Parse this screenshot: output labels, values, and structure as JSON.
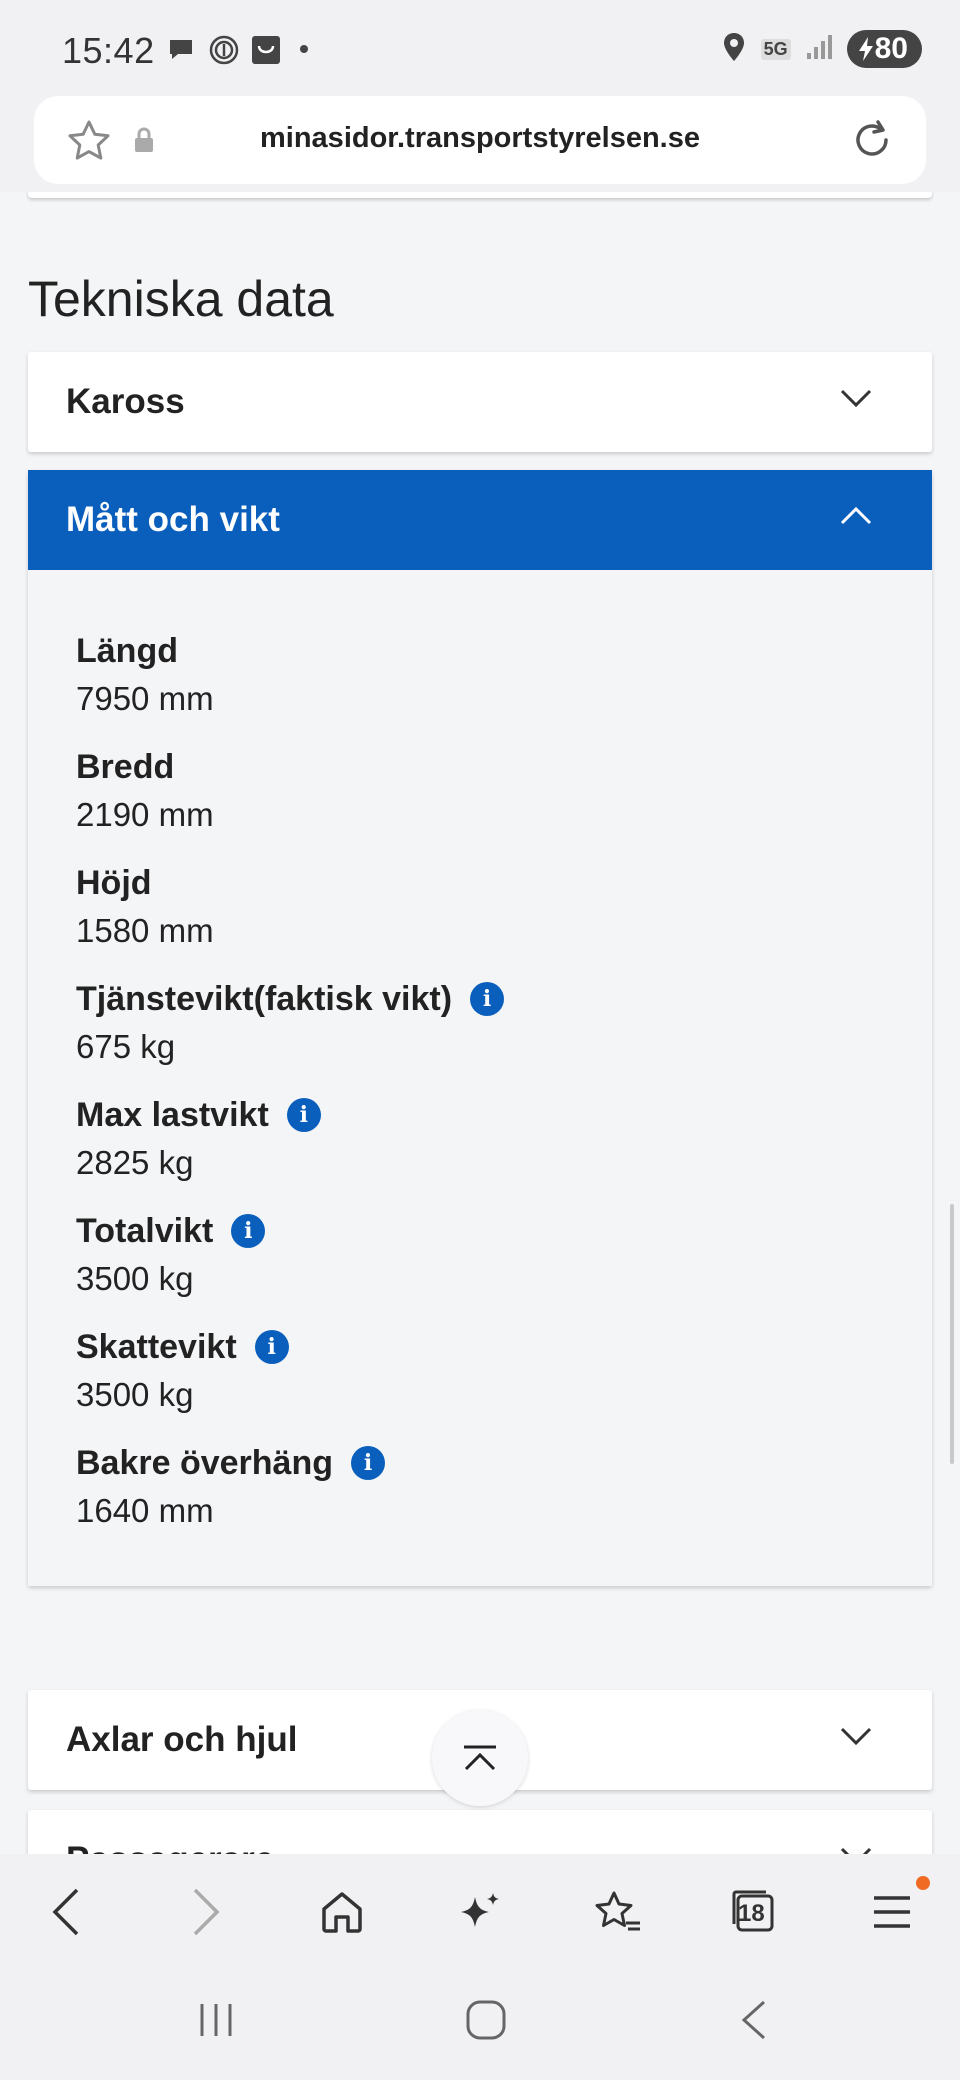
{
  "status_bar": {
    "time": "15:42",
    "network": "5G",
    "battery": "80",
    "icons": [
      "chat-icon",
      "fingerprint-icon",
      "bag-icon",
      "dot-icon",
      "location-icon",
      "signal-icon"
    ]
  },
  "browser": {
    "url": "minasidor.transportstyrelsen.se",
    "tab_count": "18"
  },
  "page": {
    "section_title": "Tekniska data",
    "accordions": [
      {
        "title": "Kaross",
        "expanded": false
      },
      {
        "title": "Mått och vikt",
        "expanded": true
      },
      {
        "title": "Axlar och hjul",
        "expanded": false
      },
      {
        "title": "Passagerare",
        "expanded": false
      }
    ],
    "specs": [
      {
        "label": "Längd",
        "value": "7950 mm",
        "info": false
      },
      {
        "label": "Bredd",
        "value": "2190 mm",
        "info": false
      },
      {
        "label": "Höjd",
        "value": "1580 mm",
        "info": false
      },
      {
        "label": "Tjänstevikt(faktisk vikt)",
        "value": "675 kg",
        "info": true
      },
      {
        "label": "Max lastvikt",
        "value": "2825 kg",
        "info": true
      },
      {
        "label": "Totalvikt",
        "value": "3500 kg",
        "info": true
      },
      {
        "label": "Skattevikt",
        "value": "3500 kg",
        "info": true
      },
      {
        "label": "Bakre överhäng",
        "value": "1640 mm",
        "info": true
      }
    ],
    "info_glyph": "i"
  },
  "colors": {
    "accent": "#0a5ebc",
    "background": "#f4f5f7",
    "notification": "#f06a24"
  }
}
